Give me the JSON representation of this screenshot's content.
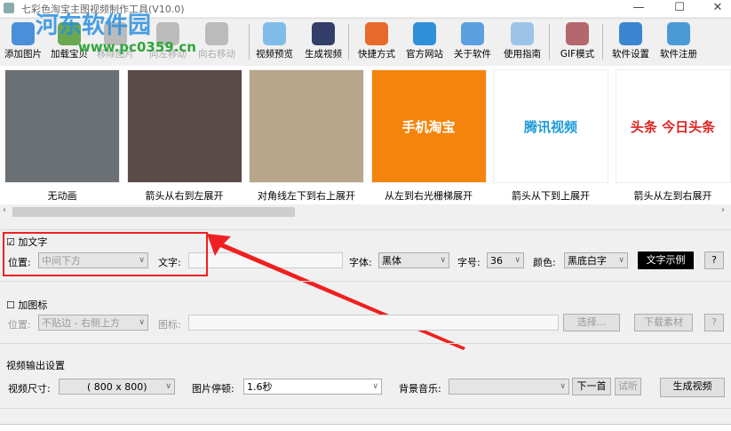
{
  "window": {
    "title": "七彩色淘宝主图视频制作工具(V10.0)",
    "minimize": "—",
    "maximize": "☐",
    "close": "✕"
  },
  "watermark": {
    "name": "河东软件园",
    "url": "www.pc0359.cn"
  },
  "toolbar": [
    {
      "label": "添加图片",
      "icon": "add-image-icon",
      "color": "#4a90d9",
      "enabled": true
    },
    {
      "label": "加载宝贝",
      "icon": "load-item-icon",
      "color": "#6aa84f",
      "enabled": true
    },
    {
      "label": "移除图片",
      "icon": "remove-image-icon",
      "color": "#bbbbbb",
      "enabled": false
    },
    {
      "label": "向左移动",
      "icon": "arrow-left-icon",
      "color": "#bbbbbb",
      "enabled": false
    },
    {
      "label": "向右移动",
      "icon": "arrow-right-icon",
      "color": "#bbbbbb",
      "enabled": false
    },
    {
      "label": "视频预览",
      "icon": "magnifier-icon",
      "color": "#7fbde8",
      "enabled": true
    },
    {
      "label": "生成视频",
      "icon": "clapperboard-icon",
      "color": "#333f6a",
      "enabled": true
    },
    {
      "label": "快捷方式",
      "icon": "cubes-icon",
      "color": "#e86a2a",
      "enabled": true
    },
    {
      "label": "官方网站",
      "icon": "ie-icon",
      "color": "#2f8fd8",
      "enabled": true
    },
    {
      "label": "关于软件",
      "icon": "info-icon",
      "color": "#5aa0e0",
      "enabled": true
    },
    {
      "label": "使用指南",
      "icon": "guide-icon",
      "color": "#9cc4e8",
      "enabled": true
    },
    {
      "label": "GIF模式",
      "icon": "gif-icon",
      "color": "#b5676e",
      "enabled": true
    },
    {
      "label": "软件设置",
      "icon": "gear-icon",
      "color": "#3a86d0",
      "enabled": true
    },
    {
      "label": "软件注册",
      "icon": "monitor-icon",
      "color": "#4a9ad8",
      "enabled": true
    }
  ],
  "thumbnails": [
    {
      "caption": "无动画",
      "bg": "#6b7075",
      "text": ""
    },
    {
      "caption": "箭头从右到左展开",
      "bg": "#5a4a48",
      "text": ""
    },
    {
      "caption": "对角线左下到右上展开",
      "bg": "#b8a68a",
      "text": ""
    },
    {
      "caption": "从左到右光栅梯展开",
      "bg": "#f5840c",
      "text": "手机淘宝"
    },
    {
      "caption": "箭头从下到上展开",
      "bg": "#ffffff",
      "text": "腾讯视频"
    },
    {
      "caption": "箭头从左到右展开",
      "bg": "#ffffff",
      "text": "头条 今日头条"
    }
  ],
  "text_section": {
    "checkbox_label": "加文字",
    "checked": true,
    "position_label": "位置:",
    "position_value": "中间下方",
    "text_label": "文字:",
    "text_value": "",
    "font_label": "字体:",
    "font_value": "黑体",
    "size_label": "字号:",
    "size_value": "36",
    "color_label": "颜色:",
    "color_value": "黑底白字",
    "sample_button": "文字示例",
    "help": "?"
  },
  "logo_section": {
    "checkbox_label": "加图标",
    "checked": false,
    "position_label": "位置:",
    "position_value": "不贴边 - 右侧上方",
    "icon_label": "图标:",
    "icon_value": "",
    "select_button": "选择...",
    "download_button": "下载素材",
    "help": "?"
  },
  "output": {
    "title": "视频输出设置",
    "size_label": "视频尺寸:",
    "size_value": "( 800 x  800)",
    "pause_label": "图片停顿:",
    "pause_value": "1.6秒",
    "music_label": "背景音乐:",
    "music_value": "",
    "next_button": "下一首",
    "listen_button": "试听",
    "generate_button": "生成视频"
  }
}
